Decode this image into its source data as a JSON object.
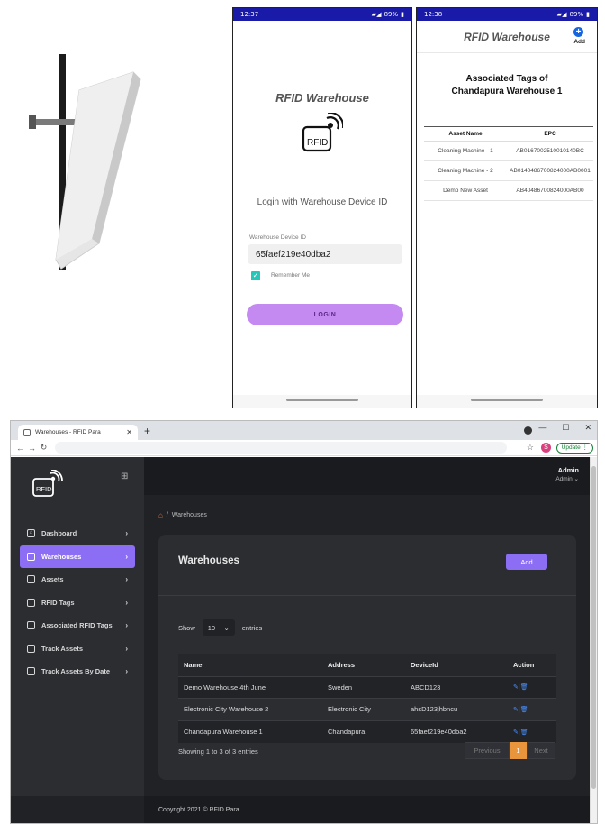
{
  "phone_login": {
    "status": {
      "time": "12:37",
      "battery": "89%"
    },
    "title": "RFID Warehouse",
    "logo_text": "RFID",
    "login_prompt": "Login with Warehouse Device ID",
    "field_label": "Warehouse Device ID",
    "field_value": "65faef219e40dba2",
    "remember_label": "Remember Me",
    "remember_checked": true,
    "login_button": "LOGIN",
    "accent_color": "#c48af2"
  },
  "phone_tags": {
    "status": {
      "time": "12:38",
      "battery": "89%"
    },
    "title": "RFID Warehouse",
    "add_label": "Add",
    "heading_line1": "Associated Tags of",
    "heading_line2": "Chandapura Warehouse 1",
    "columns": [
      "Asset Name",
      "EPC"
    ],
    "rows": [
      [
        "Cleaning Machine - 1",
        "AB0167002510010140BC"
      ],
      [
        "Cleaning Machine - 2",
        "AB0140486700824000AB0001"
      ],
      [
        "Demo New Asset",
        "AB40486700824000AB00"
      ]
    ]
  },
  "browser": {
    "tab_title": "Warehouses - RFID Para",
    "update_label": "Update",
    "profile_initial": "S"
  },
  "app": {
    "logo_text": "RFID",
    "user": {
      "name": "Admin",
      "role": "Admin ⌄"
    },
    "sidebar": [
      {
        "label": "Dashboard",
        "icon": "home-icon",
        "active": false
      },
      {
        "label": "Warehouses",
        "icon": "store-icon",
        "active": true
      },
      {
        "label": "Assets",
        "icon": "store-icon",
        "active": false
      },
      {
        "label": "RFID Tags",
        "icon": "store-icon",
        "active": false
      },
      {
        "label": "Associated RFID Tags",
        "icon": "store-icon",
        "active": false
      },
      {
        "label": "Track Assets",
        "icon": "store-icon",
        "active": false
      },
      {
        "label": "Track Assets By Date",
        "icon": "store-icon",
        "active": false
      }
    ],
    "breadcrumb": {
      "separator": "/",
      "current": "Warehouses"
    },
    "card": {
      "title": "Warehouses",
      "add_button": "Add",
      "show_label": "Show",
      "entries_value": "10",
      "entries_label": "entries",
      "columns": [
        "Name",
        "Address",
        "DeviceId",
        "Action"
      ],
      "rows": [
        {
          "name": "Demo Warehouse 4th June",
          "address": "Sweden",
          "device_id": "ABCD123"
        },
        {
          "name": "Electronic City Warehouse 2",
          "address": "Electronic City",
          "device_id": "ahsD123jhbncu"
        },
        {
          "name": "Chandapura Warehouse 1",
          "address": "Chandapura",
          "device_id": "65faef219e40dba2"
        }
      ],
      "info": "Showing 1 to 3 of 3 entries",
      "pager": {
        "previous": "Previous",
        "current": "1",
        "next": "Next"
      }
    },
    "footer": "Copyright 2021 © RFID Para",
    "colors": {
      "accent": "#8c6ef4",
      "pager_active": "#e8953c",
      "action": "#4a90ff"
    }
  }
}
